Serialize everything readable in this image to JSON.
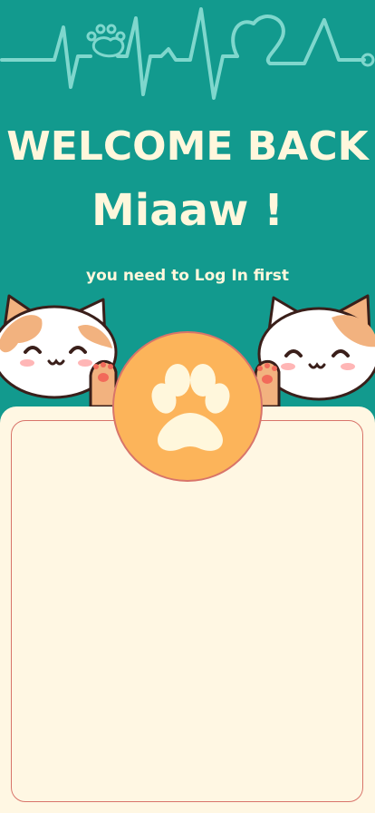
{
  "header": {
    "title": "WELCOME BACK",
    "name": "Miaaw !",
    "subtitle": "you need to Log In first"
  },
  "colors": {
    "background": "#129a8e",
    "text": "#fff7dc",
    "card": "#fff7e3",
    "card_border": "#d8746a",
    "paw_badge": "#fcb45a"
  },
  "icons": {
    "pulse": "heartbeat-line-icon",
    "paw": "paw-icon",
    "heart": "heart-icon",
    "cat": "cat-icon"
  }
}
